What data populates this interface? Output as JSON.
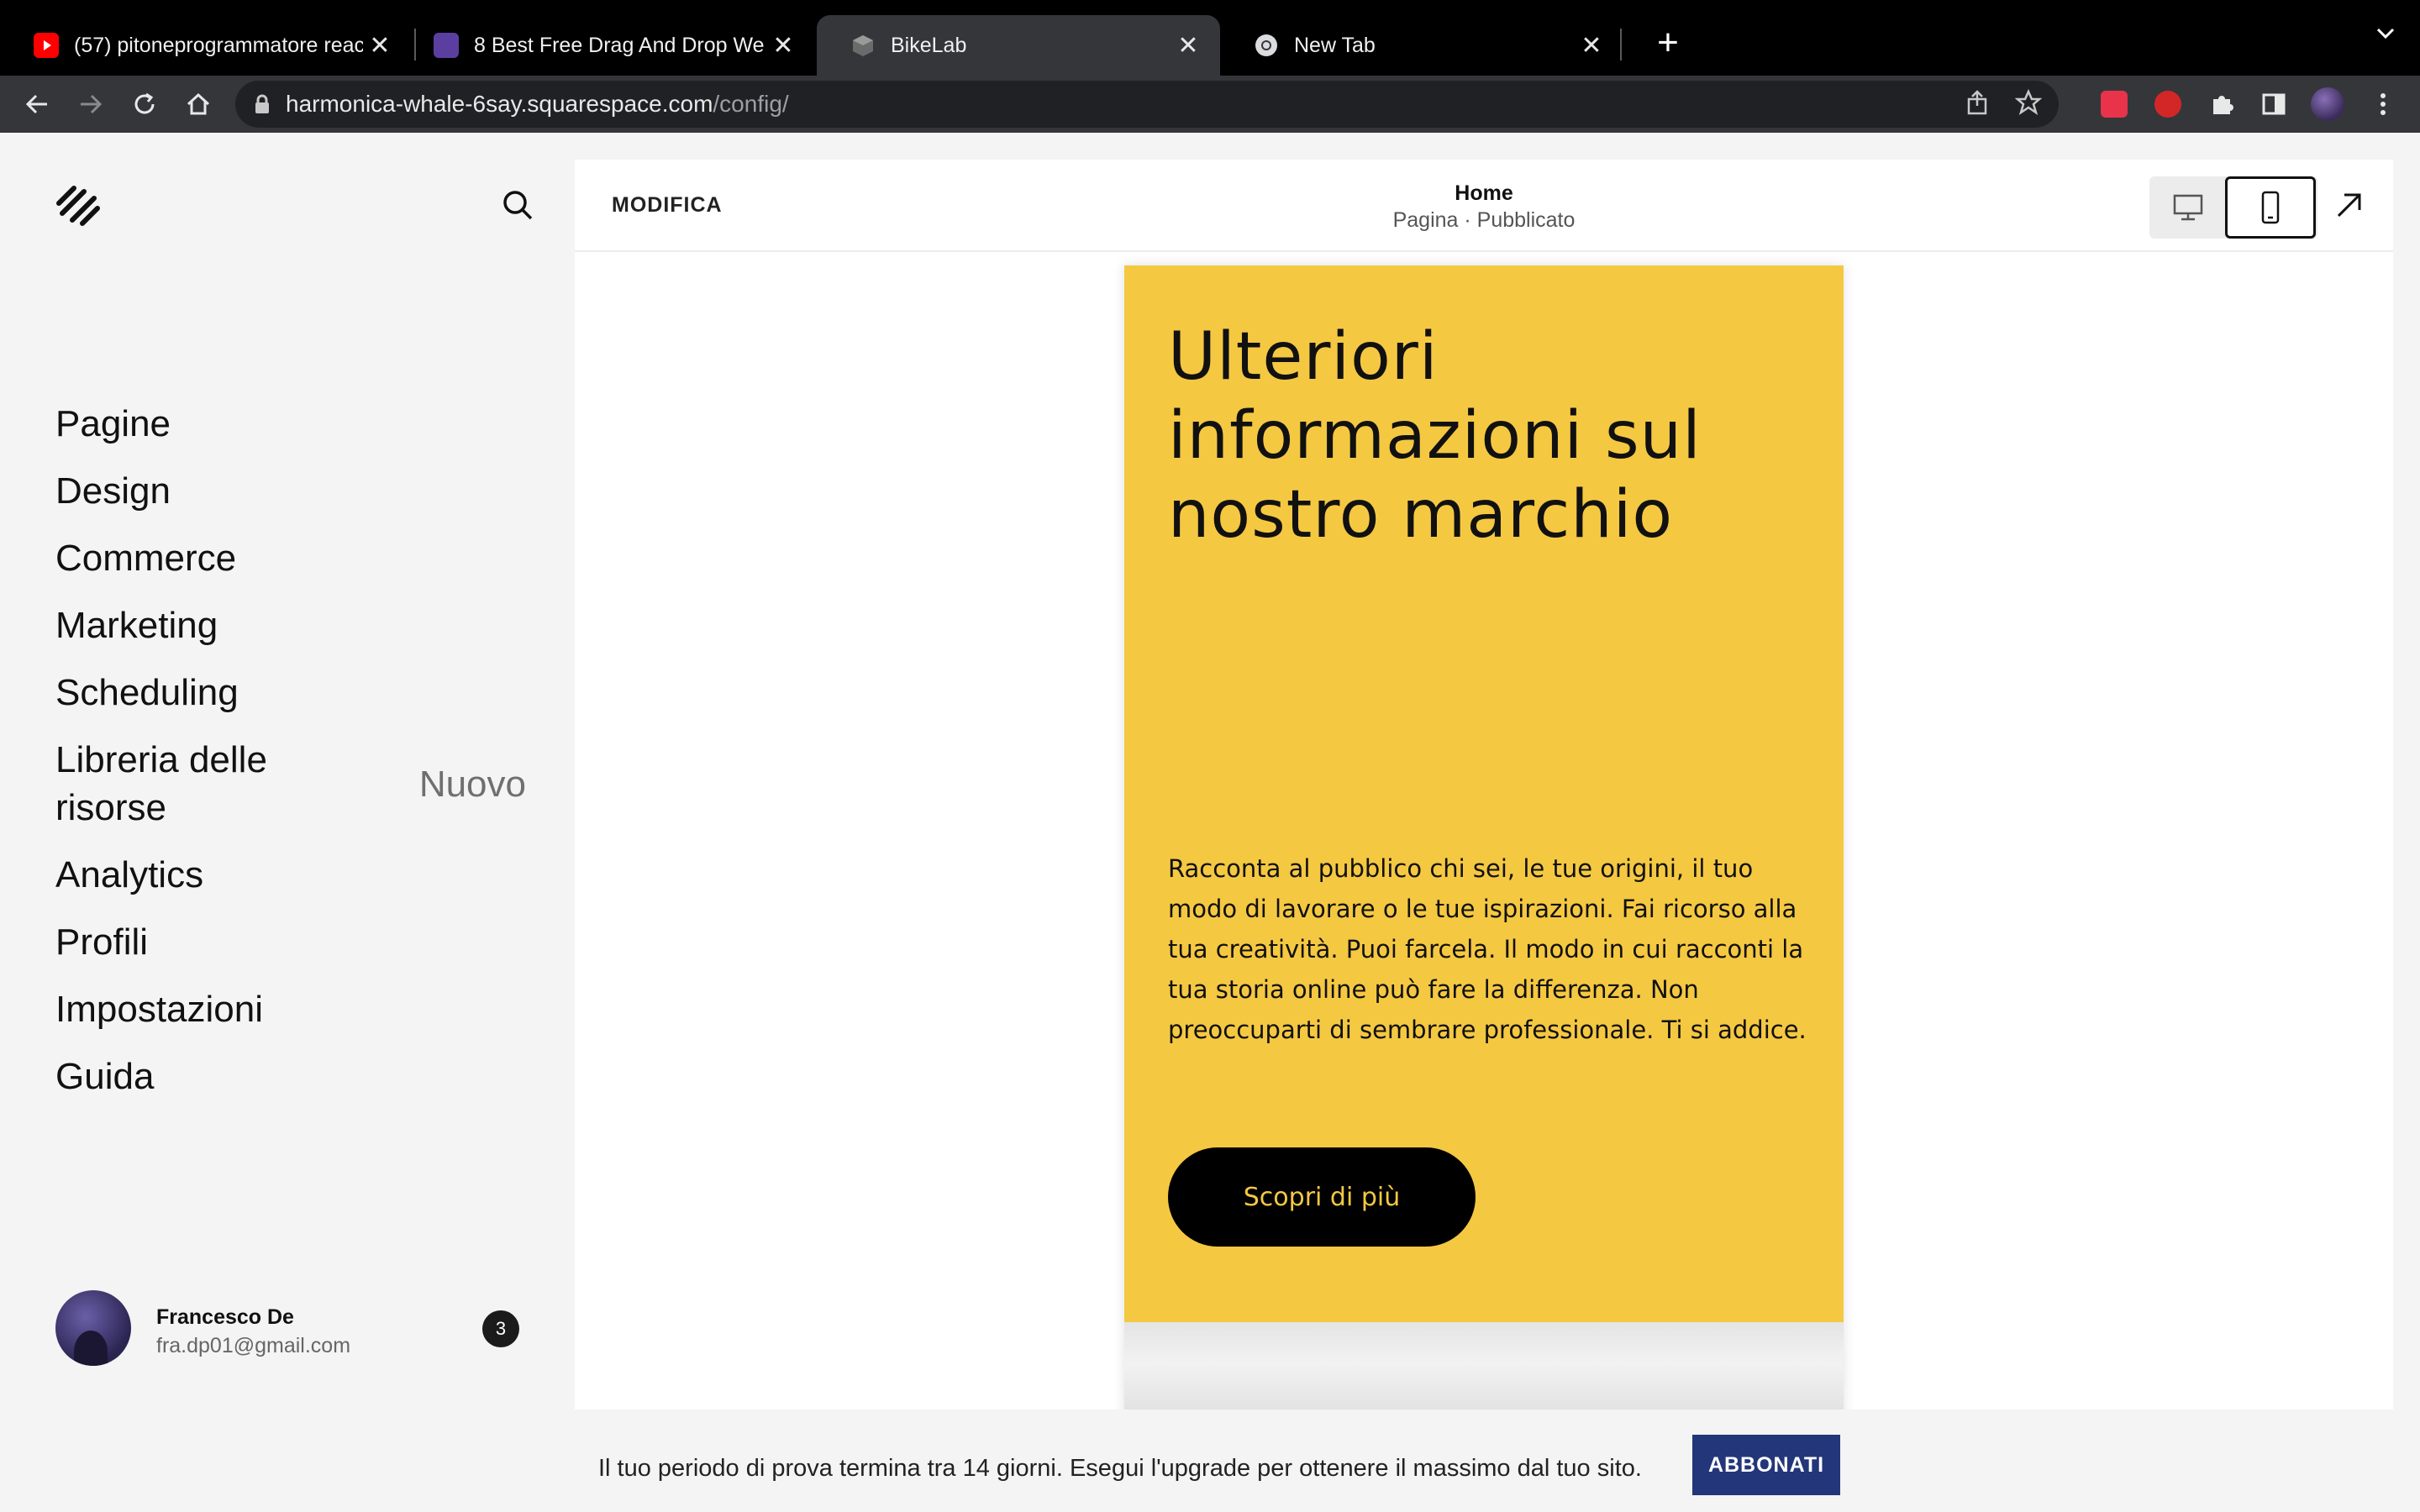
{
  "browser": {
    "tabs": [
      {
        "title": "(57) pitoneprogrammatore reac",
        "favicon": "youtube-icon"
      },
      {
        "title": "8 Best Free Drag And Drop We",
        "favicon": "colorlib-icon"
      },
      {
        "title": "BikeLab",
        "favicon": "squarespace-cube-icon"
      },
      {
        "title": "New Tab",
        "favicon": "chrome-icon"
      }
    ],
    "url_host": "harmonica-whale-6say.squarespace.com",
    "url_path": "/config/"
  },
  "sidebar": {
    "nav": [
      {
        "label": "Pagine"
      },
      {
        "label": "Design"
      },
      {
        "label": "Commerce"
      },
      {
        "label": "Marketing"
      },
      {
        "label": "Scheduling"
      },
      {
        "label": "Libreria delle risorse",
        "badge": "Nuovo"
      },
      {
        "label": "Analytics"
      },
      {
        "label": "Profili"
      },
      {
        "label": "Impostazioni"
      },
      {
        "label": "Guida"
      }
    ],
    "user": {
      "name": "Francesco De",
      "email": "fra.dp01@gmail.com",
      "notifications": "3"
    }
  },
  "editor": {
    "mode_label": "MODIFICA",
    "page_title": "Home",
    "page_status": "Pagina · Pubblicato",
    "active_view": "mobile"
  },
  "preview": {
    "heading": "Ulteriori informazioni sul nostro marchio",
    "body": "Racconta al pubblico chi sei, le tue origini, il tuo modo di lavorare o le tue ispirazioni. Fai ricorso alla tua creatività. Puoi farcela. Il modo in cui racconti la tua storia online può fare la differenza. Non preoccuparti di sembrare professionale. Ti si addice.",
    "cta_label": "Scopri di più",
    "accent_color": "#f5c842"
  },
  "trial": {
    "message": "Il tuo periodo di prova termina tra 14 giorni. Esegui l'upgrade per ottenere il massimo dal tuo sito.",
    "button_label": "ABBONATI",
    "button_color": "#23367a"
  }
}
